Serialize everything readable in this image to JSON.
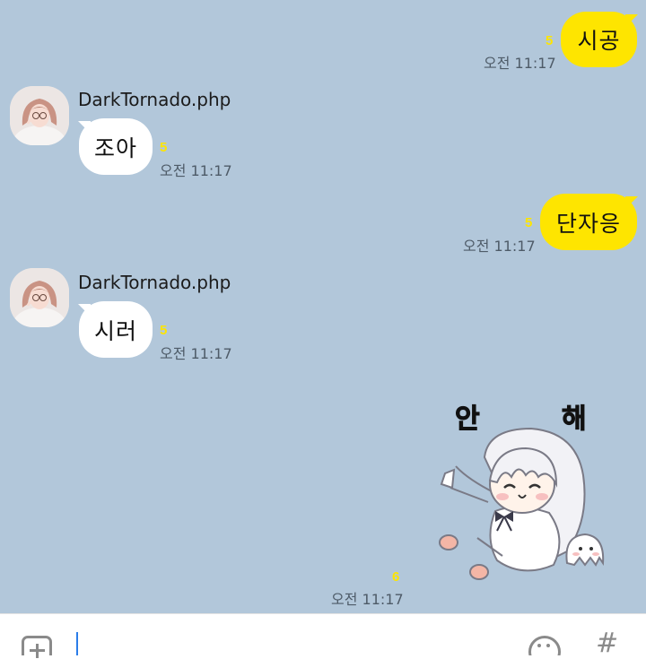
{
  "messages": [
    {
      "side": "mine",
      "text": "시공",
      "unread": "5",
      "time": "오전 11:17"
    },
    {
      "side": "theirs",
      "sender": "DarkTornado.php",
      "text": "조아",
      "unread": "5",
      "time": "오전 11:17"
    },
    {
      "side": "mine",
      "text": "단자응",
      "unread": "5",
      "time": "오전 11:17"
    },
    {
      "side": "theirs",
      "sender": "DarkTornado.php",
      "text": "시러",
      "unread": "5",
      "time": "오전 11:17"
    },
    {
      "side": "mine",
      "type": "sticker",
      "sticker_text": [
        "안",
        "해"
      ],
      "unread": "6",
      "time": "오전 11:17"
    }
  ],
  "colors": {
    "chat_background": "#b2c7da",
    "my_bubble": "#fee500",
    "their_bubble": "#ffffff",
    "unread_count": "#fee500"
  },
  "input_bar": {
    "attach_icon": "plus-square-icon",
    "emoji_icon": "emoji-face-icon",
    "hashtag_icon": "hashtag-icon",
    "hashtag_glyph": "#"
  }
}
